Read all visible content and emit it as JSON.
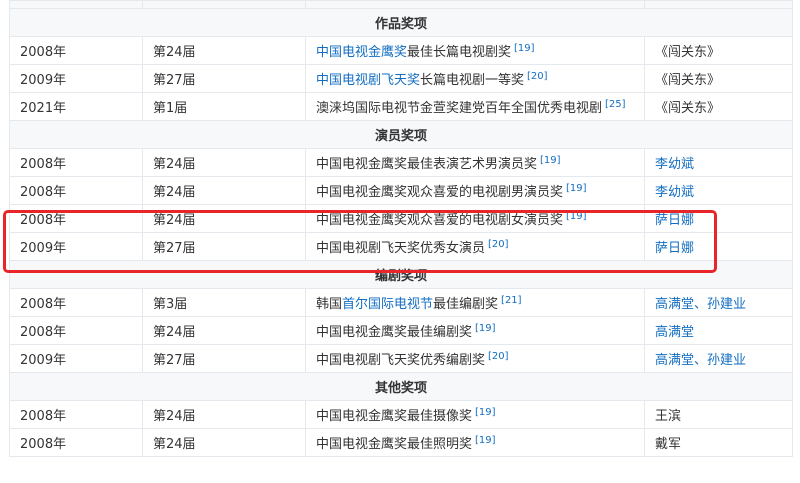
{
  "sections": [
    {
      "title": "作品奖项",
      "rows": [
        {
          "year": "2008年",
          "session": "第24届",
          "award_pre": "",
          "award_link": "中国电视金鹰奖",
          "award_post": "最佳长篇电视剧奖",
          "ref": "[19]",
          "winner": "《闯关东》",
          "winner_link": false
        },
        {
          "year": "2009年",
          "session": "第27届",
          "award_pre": "",
          "award_link": "中国电视剧飞天奖",
          "award_post": "长篇电视剧一等奖",
          "ref": "[20]",
          "winner": "《闯关东》",
          "winner_link": false
        },
        {
          "year": "2021年",
          "session": "第1届",
          "award_pre": "澳涞坞国际电视节金萱奖建党百年全国优秀电视剧",
          "award_link": "",
          "award_post": "",
          "ref": "[25]",
          "winner": "《闯关东》",
          "winner_link": false
        }
      ]
    },
    {
      "title": "演员奖项",
      "rows": [
        {
          "year": "2008年",
          "session": "第24届",
          "award_pre": "中国电视金鹰奖最佳表演艺术男演员奖",
          "award_link": "",
          "award_post": "",
          "ref": "[19]",
          "winner": "李幼斌",
          "winner_link": true
        },
        {
          "year": "2008年",
          "session": "第24届",
          "award_pre": "中国电视金鹰奖观众喜爱的电视剧男演员奖",
          "award_link": "",
          "award_post": "",
          "ref": "[19]",
          "winner": "李幼斌",
          "winner_link": true
        },
        {
          "year": "2008年",
          "session": "第24届",
          "award_pre": "中国电视金鹰奖观众喜爱的电视剧女演员奖",
          "award_link": "",
          "award_post": "",
          "ref": "[19]",
          "winner": "萨日娜",
          "winner_link": true
        },
        {
          "year": "2009年",
          "session": "第27届",
          "award_pre": "中国电视剧飞天奖优秀女演员",
          "award_link": "",
          "award_post": "",
          "ref": "[20]",
          "winner": "萨日娜",
          "winner_link": true
        }
      ]
    },
    {
      "title": "编剧奖项",
      "rows": [
        {
          "year": "2008年",
          "session": "第3届",
          "award_pre": "韩国",
          "award_link": "首尔国际电视节",
          "award_post": "最佳编剧奖",
          "ref": "[21]",
          "winner": "高满堂、孙建业",
          "winner_link": true
        },
        {
          "year": "2008年",
          "session": "第24届",
          "award_pre": "中国电视金鹰奖最佳编剧奖",
          "award_link": "",
          "award_post": "",
          "ref": "[19]",
          "winner": "高满堂",
          "winner_link": true
        },
        {
          "year": "2009年",
          "session": "第27届",
          "award_pre": "中国电视剧飞天奖优秀编剧奖",
          "award_link": "",
          "award_post": "",
          "ref": "[20]",
          "winner": "高满堂、孙建业",
          "winner_link": true
        }
      ]
    },
    {
      "title": "其他奖项",
      "rows": [
        {
          "year": "2008年",
          "session": "第24届",
          "award_pre": "中国电视金鹰奖最佳摄像奖",
          "award_link": "",
          "award_post": "",
          "ref": "[19]",
          "winner": "王滨",
          "winner_link": false
        },
        {
          "year": "2008年",
          "session": "第24届",
          "award_pre": "中国电视金鹰奖最佳照明奖",
          "award_link": "",
          "award_post": "",
          "ref": "[19]",
          "winner": "戴军",
          "winner_link": false
        }
      ]
    }
  ],
  "colors": {
    "link": "#136ec2",
    "highlight": "#e8262a",
    "border": "#e5e8ed",
    "header_bg": "#f7f8fa"
  }
}
